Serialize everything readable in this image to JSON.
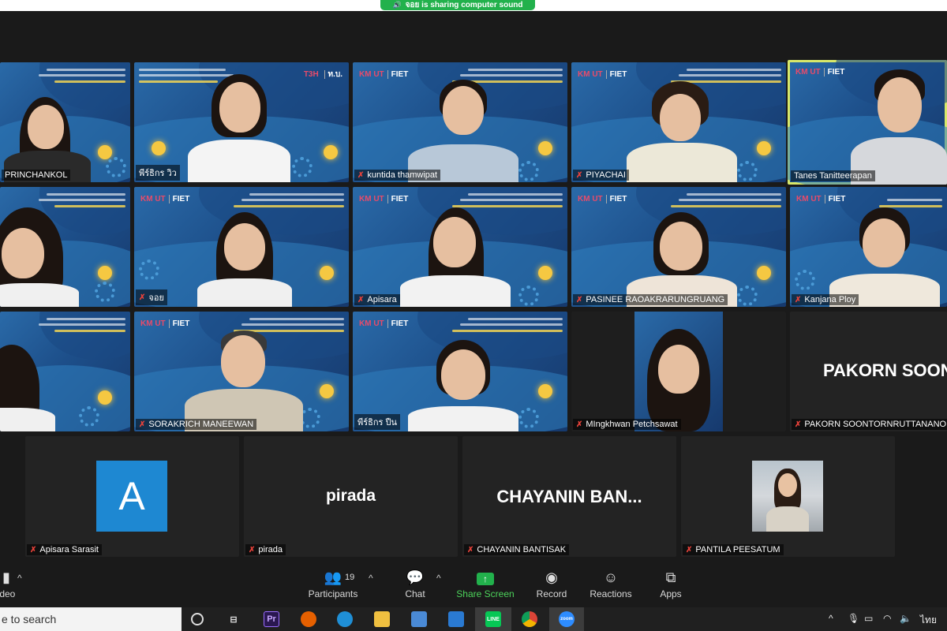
{
  "banner": {
    "text": "จอย is sharing computer sound"
  },
  "participants_grid": [
    {
      "name": "PRINCHANKOL",
      "muted": false
    },
    {
      "name": "พีร์ธิกร วิว",
      "muted": false
    },
    {
      "name": "kuntida thamwipat",
      "muted": true
    },
    {
      "name": "PIYACHAI",
      "muted": true
    },
    {
      "name": "Tanes Tanitteerapan",
      "muted": false
    },
    {
      "name": "",
      "muted": false
    },
    {
      "name": "จอย",
      "muted": true
    },
    {
      "name": "Apisara",
      "muted": true
    },
    {
      "name": "PASINEE RAOAKRARUNGRUANG",
      "muted": true
    },
    {
      "name": "Kanjana Ploy",
      "muted": true
    },
    {
      "name": "",
      "muted": false
    },
    {
      "name": "SORAKRICH MANEEWAN",
      "muted": true
    },
    {
      "name": "พีร์ธิกร ปืน",
      "muted": false
    },
    {
      "name": "MIngkhwan Petchsawat",
      "muted": true
    },
    {
      "name": "PAKORN SOONTORNRUTTANANON",
      "muted": true,
      "display": "PAKORN  SOON"
    }
  ],
  "bottom_row": [
    {
      "name": "Apisara Sarasit",
      "avatar_letter": "A"
    },
    {
      "name": "pirada",
      "display": "pirada"
    },
    {
      "name": "CHAYANIN BANTISAK",
      "display": "CHAYANIN  BAN..."
    },
    {
      "name": "PANTILA PEESATUM"
    }
  ],
  "toolbar": {
    "video_label": "ideo",
    "participants_label": "Participants",
    "participants_count": "19",
    "chat_label": "Chat",
    "share_label": "Share Screen",
    "record_label": "Record",
    "reactions_label": "Reactions",
    "apps_label": "Apps"
  },
  "taskbar": {
    "search_text": "e to search",
    "lang": "ไทย"
  },
  "colors": {
    "share_green": "#22b14c",
    "active_speaker": "#d8e86a",
    "mic_off": "#e8423a",
    "avatar_blue": "#1e88d2"
  }
}
